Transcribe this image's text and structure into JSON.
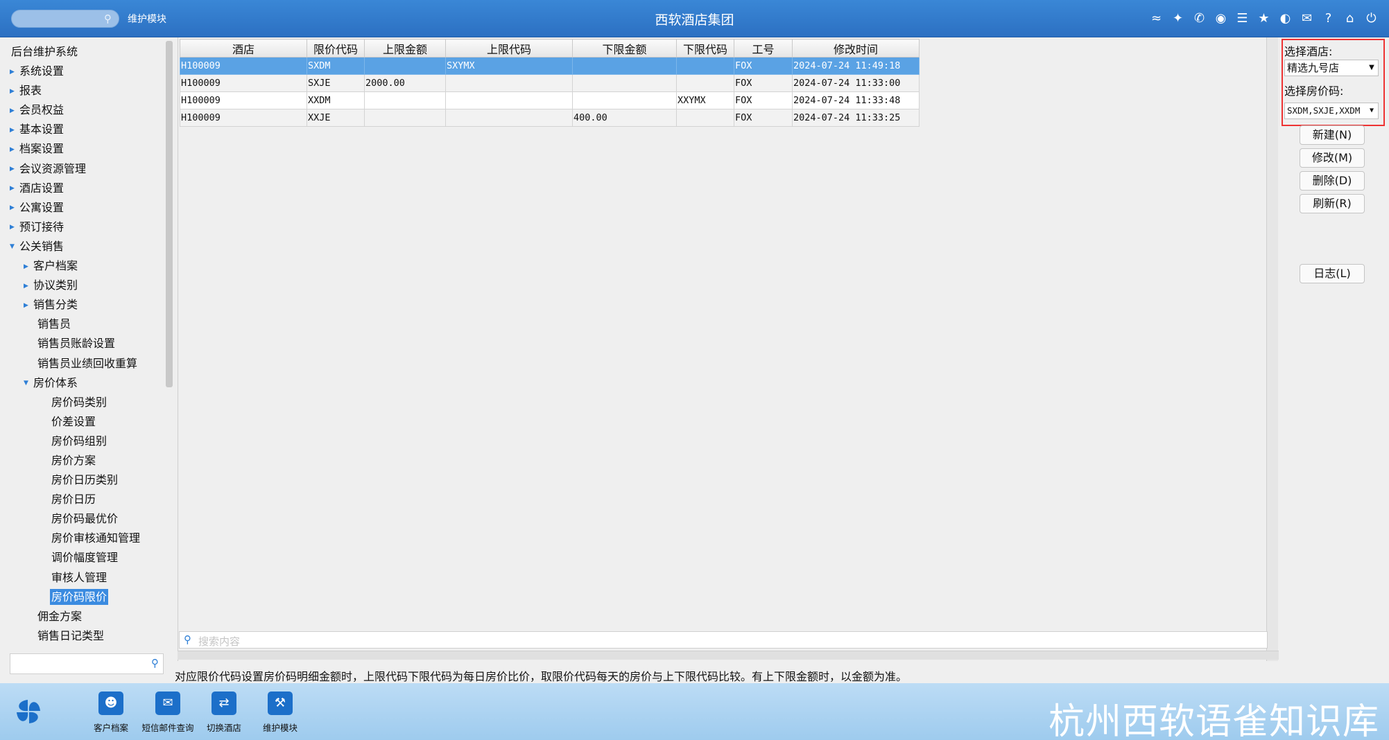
{
  "header": {
    "search_placeholder": "",
    "module_label": "维护模块",
    "title": "西软酒店集团",
    "icons": [
      "wifi-icon",
      "tools-icon",
      "phone-icon",
      "palette-icon",
      "menu-icon",
      "star-icon",
      "contrast-icon",
      "mail-icon",
      "help-icon",
      "home-icon",
      "power-icon"
    ]
  },
  "sidebar": {
    "root": "后台维护系统",
    "items": [
      {
        "label": "系统设置",
        "level": 1,
        "arrow": "right"
      },
      {
        "label": "报表",
        "level": 1,
        "arrow": "right"
      },
      {
        "label": "会员权益",
        "level": 1,
        "arrow": "right"
      },
      {
        "label": "基本设置",
        "level": 1,
        "arrow": "right"
      },
      {
        "label": "档案设置",
        "level": 1,
        "arrow": "right"
      },
      {
        "label": "会议资源管理",
        "level": 1,
        "arrow": "right"
      },
      {
        "label": "酒店设置",
        "level": 1,
        "arrow": "right"
      },
      {
        "label": "公寓设置",
        "level": 1,
        "arrow": "right"
      },
      {
        "label": "预订接待",
        "level": 1,
        "arrow": "right"
      },
      {
        "label": "公关销售",
        "level": 1,
        "arrow": "down"
      },
      {
        "label": "客户档案",
        "level": 2,
        "arrow": "right"
      },
      {
        "label": "协议类别",
        "level": 2,
        "arrow": "right"
      },
      {
        "label": "销售分类",
        "level": 2,
        "arrow": "right"
      },
      {
        "label": "销售员",
        "level": 2,
        "arrow": ""
      },
      {
        "label": "销售员账龄设置",
        "level": 2,
        "arrow": ""
      },
      {
        "label": "销售员业绩回收重算",
        "level": 2,
        "arrow": ""
      },
      {
        "label": "房价体系",
        "level": 2,
        "arrow": "down"
      },
      {
        "label": "房价码类别",
        "level": 3,
        "arrow": ""
      },
      {
        "label": "价差设置",
        "level": 3,
        "arrow": ""
      },
      {
        "label": "房价码组别",
        "level": 3,
        "arrow": ""
      },
      {
        "label": "房价方案",
        "level": 3,
        "arrow": ""
      },
      {
        "label": "房价日历类别",
        "level": 3,
        "arrow": ""
      },
      {
        "label": "房价日历",
        "level": 3,
        "arrow": ""
      },
      {
        "label": "房价码最优价",
        "level": 3,
        "arrow": ""
      },
      {
        "label": "房价审核通知管理",
        "level": 3,
        "arrow": ""
      },
      {
        "label": "调价幅度管理",
        "level": 3,
        "arrow": ""
      },
      {
        "label": "审核人管理",
        "level": 3,
        "arrow": ""
      },
      {
        "label": "房价码限价",
        "level": 3,
        "arrow": "",
        "selected": true
      },
      {
        "label": "佣金方案",
        "level": 2,
        "arrow": ""
      },
      {
        "label": "销售日记类型",
        "level": 2,
        "arrow": ""
      }
    ],
    "search_placeholder": ""
  },
  "grid": {
    "columns": [
      "酒店",
      "限价代码",
      "上限金额",
      "上限代码",
      "下限金额",
      "下限代码",
      "工号",
      "修改时间"
    ],
    "rows": [
      [
        "H100009",
        "SXDM",
        "",
        "SXYMX",
        "",
        "",
        "FOX",
        "2024-07-24 11:49:18"
      ],
      [
        "H100009",
        "SXJE",
        "2000.00",
        "",
        "",
        "",
        "FOX",
        "2024-07-24 11:33:00"
      ],
      [
        "H100009",
        "XXDM",
        "",
        "",
        "",
        "XXYMX",
        "FOX",
        "2024-07-24 11:33:48"
      ],
      [
        "H100009",
        "XXJE",
        "",
        "",
        "400.00",
        "",
        "FOX",
        "2024-07-24 11:33:25"
      ]
    ],
    "selected_row": 0,
    "search_placeholder": "搜索内容"
  },
  "hint": "对应限价代码设置房价码明细金额时，上限代码下限代码为每日房价比价，取限价代码每天的房价与上下限代码比较。有上下限金额时，以金额为准。",
  "filters": {
    "hotel_label": "选择酒店:",
    "hotel_value": "精选九号店",
    "ratecode_label": "选择房价码:",
    "ratecode_value": "SXDM,SXJE,XXDM"
  },
  "actions": {
    "new": "新建(N)",
    "edit": "修改(M)",
    "delete": "删除(D)",
    "refresh": "刷新(R)",
    "log": "日志(L)"
  },
  "footer": {
    "buttons": [
      {
        "label": "客户档案",
        "icon": "contact-card-icon"
      },
      {
        "label": "短信邮件查询",
        "icon": "mail-icon"
      },
      {
        "label": "切换酒店",
        "icon": "switch-icon"
      },
      {
        "label": "维护模块",
        "icon": "wrench-icon"
      }
    ],
    "watermark": "杭州西软语雀知识库"
  },
  "colors": {
    "header": "#2f78c8",
    "selection": "#5aa2e4",
    "accent": "#2e7fd6",
    "highlight_box": "#e33333"
  }
}
